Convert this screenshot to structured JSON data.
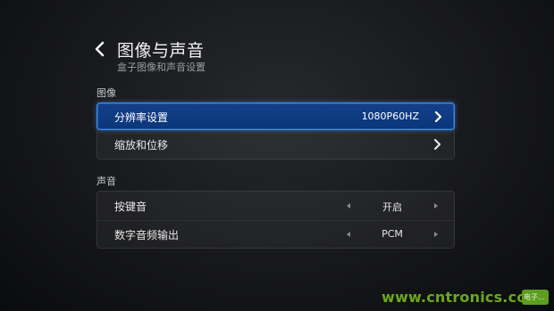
{
  "header": {
    "title": "图像与声音",
    "subtitle": "盒子图像和声音设置",
    "back_icon": "chevron-left-icon"
  },
  "sections": [
    {
      "label": "图像",
      "rows": [
        {
          "label": "分辨率设置",
          "value": "1080P60HZ",
          "control": "chevron-right-icon",
          "selected": true
        },
        {
          "label": "缩放和位移",
          "value": "",
          "control": "chevron-right-icon",
          "selected": false
        }
      ]
    },
    {
      "label": "声音",
      "rows": [
        {
          "label": "按键音",
          "value": "开启",
          "control": "left-right-selector"
        },
        {
          "label": "数字音频输出",
          "value": "PCM",
          "control": "left-right-selector"
        }
      ]
    }
  ],
  "watermark": {
    "text": "www.cntronics.com",
    "badge": "电子..."
  },
  "colors": {
    "selection_fill": "#0c3679",
    "selection_border": "#3b8df0",
    "watermark_green": "#6aa81f"
  }
}
